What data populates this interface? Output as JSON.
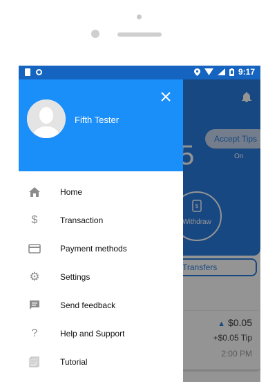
{
  "status_bar": {
    "time": "9:17"
  },
  "app": {
    "accept_tips_label": "Accept Tips",
    "accept_tips_state": "On",
    "balance_digit": "5",
    "withdraw_label": "Withdraw",
    "transfers_label": "Transfers",
    "transaction": {
      "amount": "$0.05",
      "tip": "+$0.05 Tip",
      "time": "2:00 PM"
    }
  },
  "drawer": {
    "user_name": "Fifth Tester",
    "items": [
      {
        "label": "Home",
        "icon": "home-icon"
      },
      {
        "label": "Transaction",
        "icon": "dollar-icon"
      },
      {
        "label": "Payment methods",
        "icon": "card-icon"
      },
      {
        "label": "Settings",
        "icon": "gear-icon"
      },
      {
        "label": "Send feedback",
        "icon": "feedback-icon"
      },
      {
        "label": "Help and Support",
        "icon": "question-icon"
      },
      {
        "label": "Tutorial",
        "icon": "tutorial-icon"
      }
    ]
  },
  "colors": {
    "drawer_header": "#1a8ef9",
    "status_bar": "#1565c0",
    "app_primary": "#2a7de1"
  }
}
